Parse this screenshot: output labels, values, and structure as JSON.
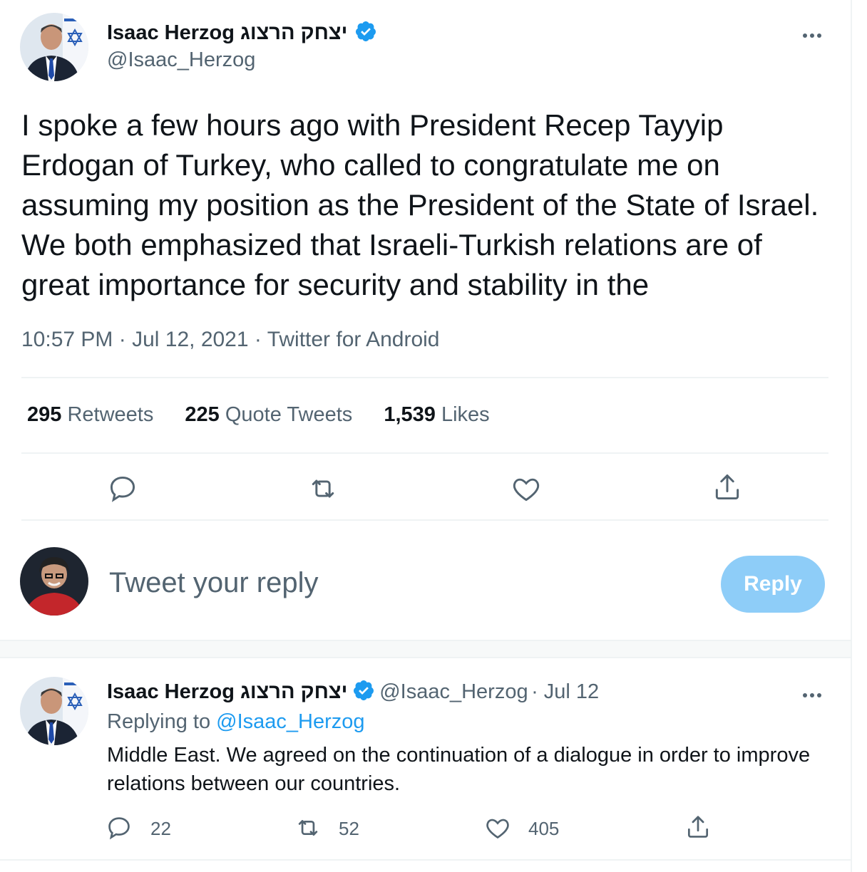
{
  "main_tweet": {
    "author_name": "Isaac Herzog יצחק הרצוג",
    "handle": "@Isaac_Herzog",
    "text": "I spoke a few hours ago with  President Recep Tayyip Erdogan of Turkey, who called to congratulate me on assuming my position as the President of the State of Israel.  We both emphasized that Israeli-Turkish relations are of great importance for security and stability in the",
    "time": "10:57 PM",
    "date": "Jul 12, 2021",
    "source": "Twitter for Android",
    "stats": {
      "retweets_count": "295",
      "retweets_label": "Retweets",
      "quotes_count": "225",
      "quotes_label": "Quote Tweets",
      "likes_count": "1,539",
      "likes_label": "Likes"
    }
  },
  "reply_box": {
    "placeholder": "Tweet your reply",
    "button_label": "Reply"
  },
  "thread_tweet": {
    "author_name": "Isaac Herzog יצחק הרצוג",
    "handle": "@Isaac_Herzog",
    "date": "· Jul 12",
    "replying_prefix": "Replying to",
    "replying_handle": "@Isaac_Herzog",
    "text": "Middle East.  We agreed on the continuation of a dialogue in order to improve relations between our countries.",
    "reply_count": "22",
    "retweet_count": "52",
    "like_count": "405"
  },
  "colors": {
    "accent": "#1d9bf0",
    "reply_button_disabled": "#8ecdf8",
    "secondary_text": "#536471"
  },
  "icons": [
    "verified-badge-icon",
    "more-icon",
    "reply-icon",
    "retweet-icon",
    "like-icon",
    "share-icon"
  ]
}
